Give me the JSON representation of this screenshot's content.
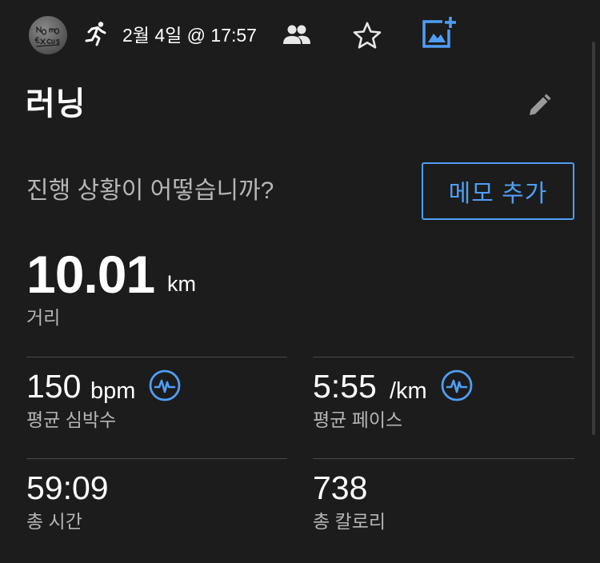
{
  "header": {
    "avatar_text": "No more Excuses",
    "activity_icon": "running-icon",
    "date": "2월 4일 @ 17:57",
    "icons": [
      "people-icon",
      "star-icon",
      "add-photo-icon"
    ]
  },
  "activity": {
    "title": "러닝",
    "edit_icon": "pencil-icon"
  },
  "memo": {
    "prompt": "진행 상황이 어떻습니까?",
    "button_label": "메모 추가"
  },
  "distance": {
    "value": "10.01",
    "unit": "km",
    "label": "거리"
  },
  "stats": [
    {
      "value": "150",
      "unit": "bpm",
      "label": "평균 심박수",
      "icon": "heart-rate-icon"
    },
    {
      "value": "5:55",
      "unit": "/km",
      "label": "평균 페이스",
      "icon": "heart-rate-icon"
    },
    {
      "value": "59:09",
      "unit": "",
      "label": "총 시간"
    },
    {
      "value": "738",
      "unit": "",
      "label": "총 칼로리"
    }
  ],
  "colors": {
    "background": "#1c1c1c",
    "accent": "#4f9ef3",
    "text": "#ffffff",
    "muted": "#b5b5b5",
    "divider": "#4a4a4a"
  }
}
